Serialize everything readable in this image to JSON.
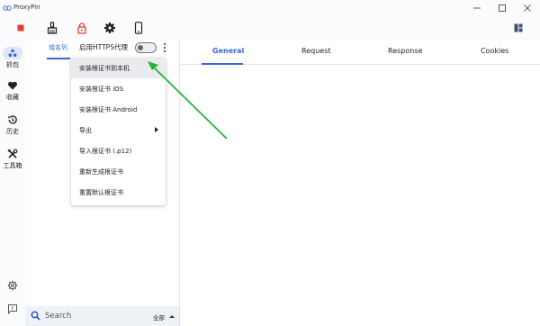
{
  "window": {
    "title": "ProxyPin",
    "minimize_icon": "minimize-icon",
    "maximize_icon": "maximize-icon",
    "close_icon": "close-icon"
  },
  "toolbar": {
    "icons": [
      "stop-icon",
      "broom-icon",
      "lock-icon",
      "gear-icon",
      "phone-icon"
    ],
    "stop_color": "#e53935",
    "lock_color": "#e53935",
    "right_icon": "layout-icon"
  },
  "sidebar": {
    "items": [
      {
        "label": "抓包",
        "icon": "network-icon",
        "selected": true
      },
      {
        "label": "收藏",
        "icon": "heart-icon"
      },
      {
        "label": "历史",
        "icon": "history-icon"
      },
      {
        "label": "工具箱",
        "icon": "tools-icon"
      }
    ],
    "bottom_icons": [
      "settings-icon",
      "feedback-icon"
    ]
  },
  "left_panel": {
    "tab_label": "域名列",
    "https_label": "启用HTTPS代理",
    "https_enabled": false,
    "search_placeholder": "Search",
    "filter_label": "全部"
  },
  "menu": {
    "items": [
      {
        "label": "安装根证书到本机",
        "highlighted": true
      },
      {
        "label": "安装根证书 iOS"
      },
      {
        "label": "安装根证书 Android"
      },
      {
        "label": "导出",
        "submenu": true
      },
      {
        "label": "导入根证书 (.p12)"
      },
      {
        "label": "重新生成根证书"
      },
      {
        "label": "重置默认根证书"
      }
    ]
  },
  "tabs": [
    {
      "label": "General",
      "active": true
    },
    {
      "label": "Request"
    },
    {
      "label": "Response"
    },
    {
      "label": "Cookies"
    }
  ],
  "colors": {
    "accent": "#3a66d6",
    "annotation_arrow": "#27b33a"
  }
}
